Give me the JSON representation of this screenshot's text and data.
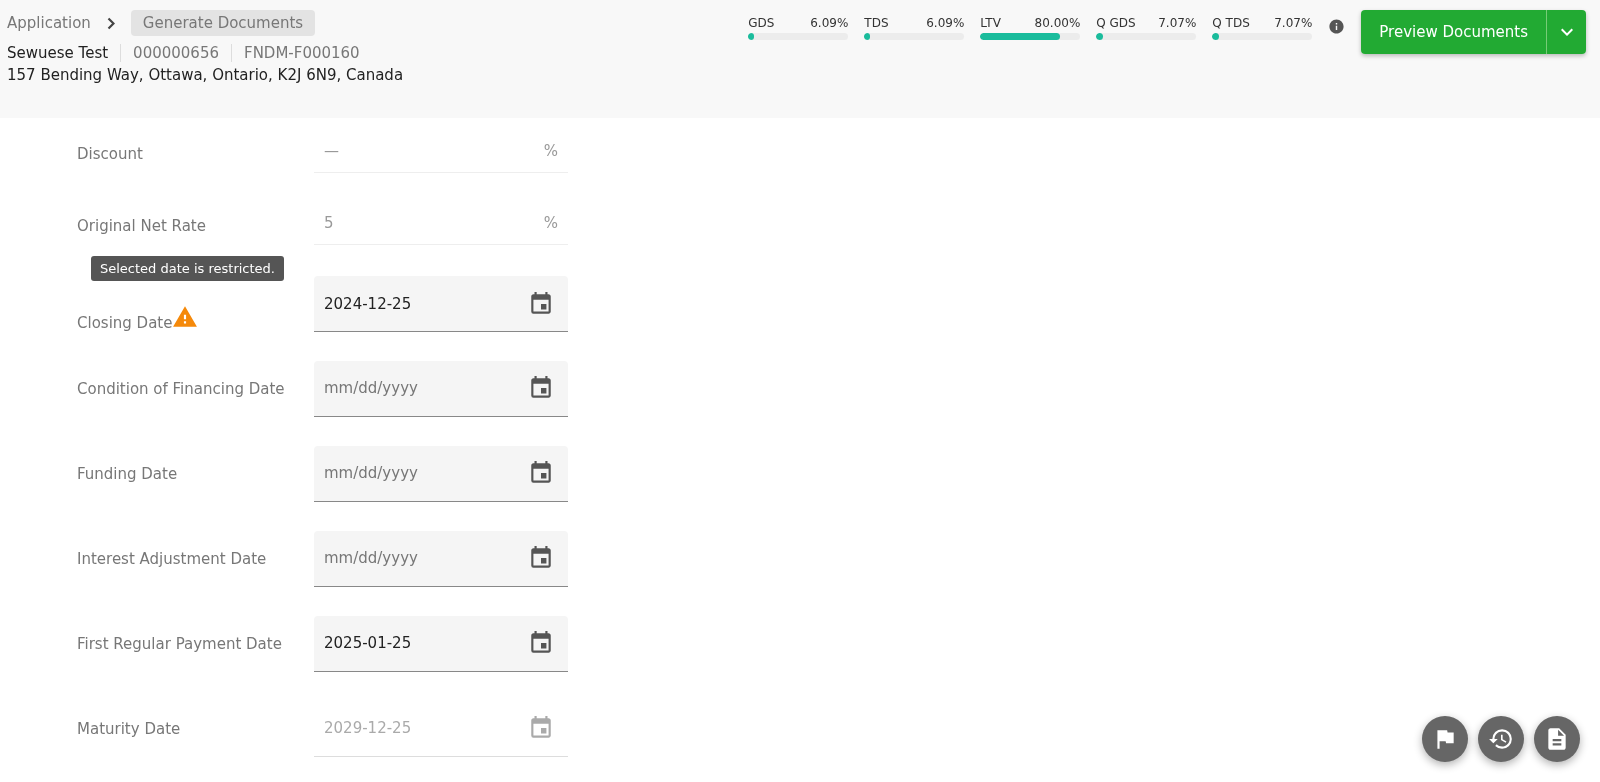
{
  "breadcrumb": [
    {
      "label": "Application",
      "current": false
    },
    {
      "label": "Generate Documents",
      "current": true
    }
  ],
  "applicant": {
    "name": "Sewuese Test",
    "number": "000000656",
    "reference": "FNDM-F000160",
    "address": "157 Bending Way, Ottawa, Ontario, K2J 6N9, Canada"
  },
  "ratios": [
    {
      "name": "GDS",
      "reading": "6.09%",
      "level": 0.06
    },
    {
      "name": "TDS",
      "reading": "6.09%",
      "level": 0.06
    },
    {
      "name": "LTV",
      "reading": "80.00%",
      "level": 0.8
    },
    {
      "name": "Q GDS",
      "reading": "7.07%",
      "level": 0.07
    },
    {
      "name": "Q TDS",
      "reading": "7.07%",
      "level": 0.07
    }
  ],
  "preview_button": {
    "label": "Preview Documents"
  },
  "fields": [
    {
      "kind": "percent",
      "label": "Discount",
      "value": "—",
      "unit": "%"
    },
    {
      "kind": "percent",
      "label": "Original Net Rate",
      "value": "5",
      "unit": "%"
    },
    {
      "kind": "date",
      "label": "Closing Date",
      "value": "2024-12-25",
      "disabled": false,
      "warning": true,
      "tooltip": "Selected date is restricted."
    },
    {
      "kind": "date",
      "label": "Condition of Financing Date",
      "placeholder": "mm/dd/yyyy",
      "disabled": false,
      "warning": false
    },
    {
      "kind": "date",
      "label": "Funding Date",
      "placeholder": "mm/dd/yyyy",
      "disabled": false,
      "warning": false
    },
    {
      "kind": "date",
      "label": "Interest Adjustment Date",
      "placeholder": "mm/dd/yyyy",
      "disabled": false,
      "warning": false
    },
    {
      "kind": "date",
      "label": "First Regular Payment Date",
      "value": "2025-01-25",
      "disabled": false,
      "warning": false
    },
    {
      "kind": "date",
      "label": "Maturity Date",
      "value": "2029-12-25",
      "disabled": true,
      "warning": false
    }
  ]
}
